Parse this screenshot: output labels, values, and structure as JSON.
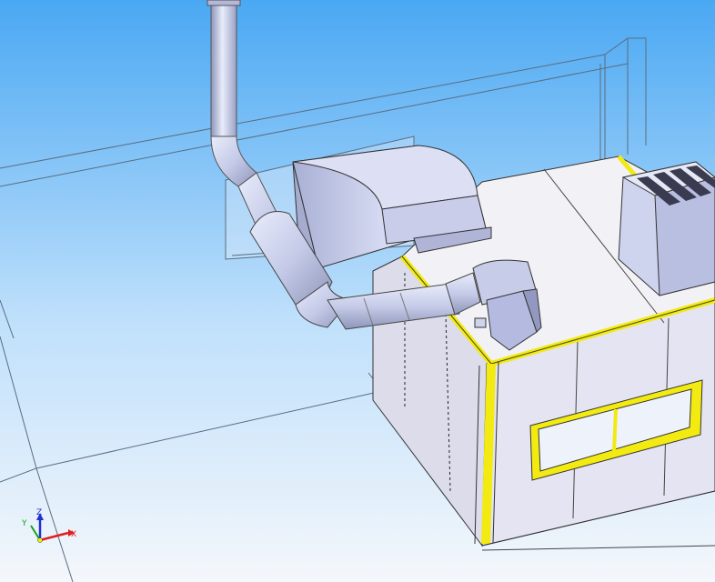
{
  "viewport": {
    "background_top": "#4aa8f3",
    "background_bottom": "#f4f7fb"
  },
  "triad": {
    "x_label": "X",
    "y_label": "Y",
    "z_label": "Z",
    "x_color": "#e02020",
    "y_color": "#18a018",
    "z_color": "#2030d0"
  },
  "colors": {
    "edge_highlight": "#f2ea10",
    "duct_metal": "#c5cbe8",
    "panel": "#e4e4f2",
    "roof": "#f2f2f6",
    "filter_fins": "#3a3a50"
  }
}
